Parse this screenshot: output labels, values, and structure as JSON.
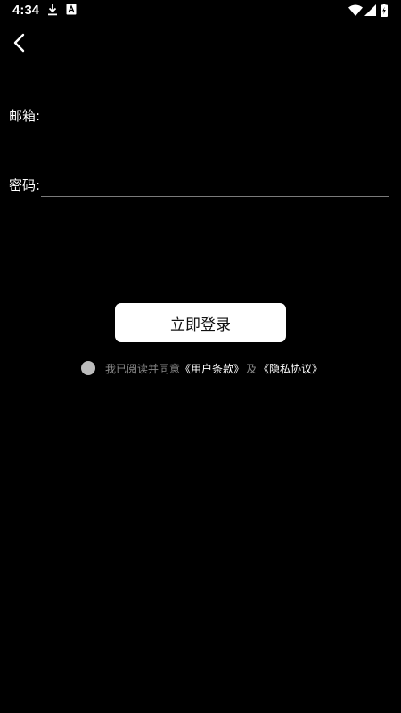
{
  "status_bar": {
    "time": "4:34",
    "icons": [
      "download-icon",
      "app-notification-icon",
      "wifi-icon",
      "signal-icon",
      "battery-charging-icon"
    ]
  },
  "nav": {
    "back_icon": "chevron-left-icon"
  },
  "form": {
    "email_label": "邮箱:",
    "email_value": "",
    "password_label": "密码:",
    "password_value": ""
  },
  "actions": {
    "login_label": "立即登录"
  },
  "agreement": {
    "prefix": "我已阅读并同意",
    "terms_link": "《用户条款》",
    "conjunction": "及",
    "privacy_link": "《隐私协议》"
  },
  "colors": {
    "background": "#000000",
    "button_bg": "#ffffff",
    "button_text": "#111111",
    "muted_text": "#8a8a8a",
    "underline": "#7a7a7a"
  }
}
